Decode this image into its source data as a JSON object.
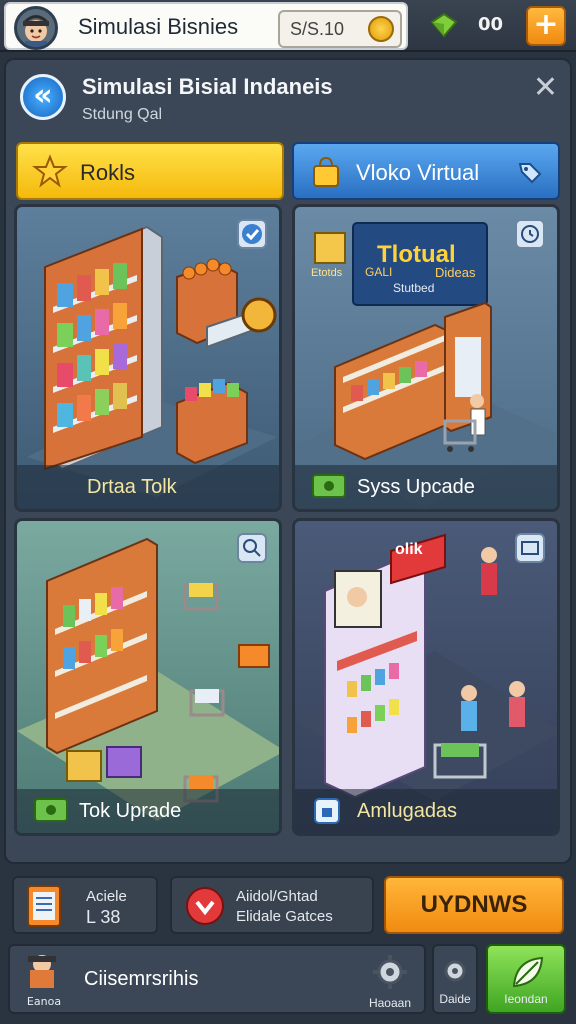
{
  "header": {
    "title": "Simulasi Bisnies",
    "coin_value": "S/S.10",
    "gem_value": "00",
    "plus_label": "+"
  },
  "panel": {
    "title": "Simulasi Bisial Indaneis",
    "subtitle": "Stdung Qal",
    "close_label": "✕"
  },
  "tabs": {
    "left_label": "Rokls",
    "right_label": "Vloko Virtual"
  },
  "cards": {
    "c1_label": "Drtaa Tolk",
    "c2_sign_title": "Tlotual",
    "c2_sign_sub": "Stutbed",
    "c2_left_sign": "Etotds",
    "c2_mid_sign": "GALI",
    "c2_right_sign": "Dideas",
    "c2_label": "Syss Upcade",
    "c3_label": "Tok Uprade",
    "c4_sign": "olik",
    "c4_label": "Amlugadas"
  },
  "bottom": {
    "stat1_line1": "Aciele",
    "stat1_line2": "L 38",
    "stat2_line1": "Aiidol/Ghtad",
    "stat2_line2": "Elidale Gatces",
    "buy_label": "UYDNWS",
    "nav1_title": "Ciisemrsrihis",
    "nav1_sub": "Eanoa",
    "nav2_label": "Haoaan",
    "nav3_label": "Daide",
    "nav4_label": "Ieondan"
  }
}
